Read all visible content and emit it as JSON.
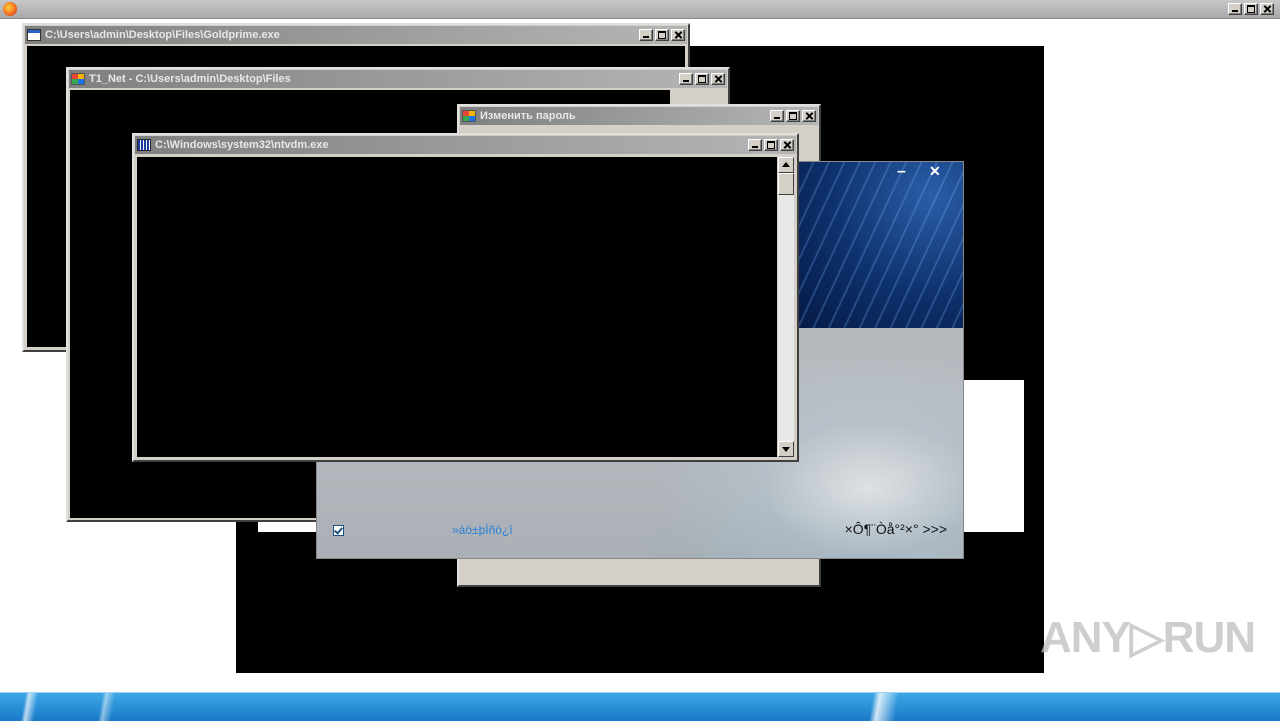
{
  "windows": {
    "goldprime": {
      "title": "C:\\Users\\admin\\Desktop\\Files\\Goldprime.exe"
    },
    "t1net": {
      "title": "T1_Net - C:\\Users\\admin\\Desktop\\Files"
    },
    "password": {
      "title": "Изменить пароль"
    },
    "ntvdm": {
      "title": "C:\\Windows\\system32\\ntvdm.exe"
    }
  },
  "installer": {
    "minimize_glyph": "–",
    "close_glyph": "✕",
    "checkbox_checked": true,
    "link_text": "»áö±þÌñö¿î",
    "next_text": "×Ô¶¨Òå°²×° >>>"
  },
  "watermark": {
    "text": "ANY▷RUN"
  },
  "colors": {
    "titlebar_inactive": "#808080",
    "console_bg": "#000000",
    "installer_link": "#2a7fd8",
    "taskbar": "#1879c8"
  },
  "icons": [
    "firefox-icon",
    "console-icon",
    "app-icon",
    "dos-icon",
    "check-icon"
  ]
}
